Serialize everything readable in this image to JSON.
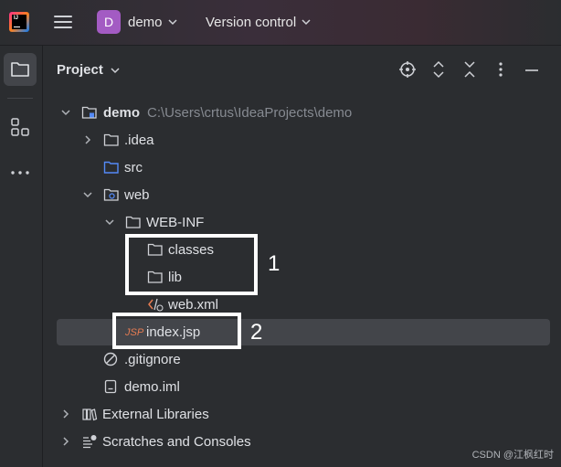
{
  "app": {
    "logo_text": "IJ",
    "logo_icon": "intellij-logo-icon"
  },
  "topbar": {
    "project_badge": "D",
    "project_name": "demo",
    "vcs_label": "Version control"
  },
  "panel": {
    "title": "Project",
    "actions": [
      "locate-icon",
      "expand-collapse-icon",
      "collapse-all-icon",
      "more-options-icon",
      "hide-icon"
    ]
  },
  "tree": [
    {
      "name": "demo",
      "path": "C:\\Users\\crtus\\IdeaProjects\\demo",
      "icon": "module-folder-icon",
      "expanded": true
    },
    {
      "name": ".idea",
      "icon": "folder-icon",
      "expanded": false
    },
    {
      "name": "src",
      "icon": "source-folder-icon"
    },
    {
      "name": "web",
      "icon": "web-folder-icon",
      "expanded": true
    },
    {
      "name": "WEB-INF",
      "icon": "folder-icon",
      "expanded": true
    },
    {
      "name": "classes",
      "icon": "folder-icon"
    },
    {
      "name": "lib",
      "icon": "folder-icon"
    },
    {
      "name": "web.xml",
      "icon": "xml-file-icon"
    },
    {
      "name": "index.jsp",
      "icon": "jsp-file-icon",
      "selected": true
    },
    {
      "name": ".gitignore",
      "icon": "ignored-file-icon"
    },
    {
      "name": "demo.iml",
      "icon": "iml-file-icon"
    },
    {
      "name": "External Libraries",
      "icon": "libraries-icon",
      "expanded": false
    },
    {
      "name": "Scratches and Consoles",
      "icon": "scratches-icon",
      "expanded": false
    }
  ],
  "annotations": {
    "box1": "1",
    "box2": "2"
  },
  "watermark": "CSDN @江枫红时",
  "colors": {
    "background": "#2b2d30",
    "selection": "#43454a",
    "project_badge": "#a35bc3",
    "source_folder": "#548af7",
    "jsp": "#e67c52"
  }
}
